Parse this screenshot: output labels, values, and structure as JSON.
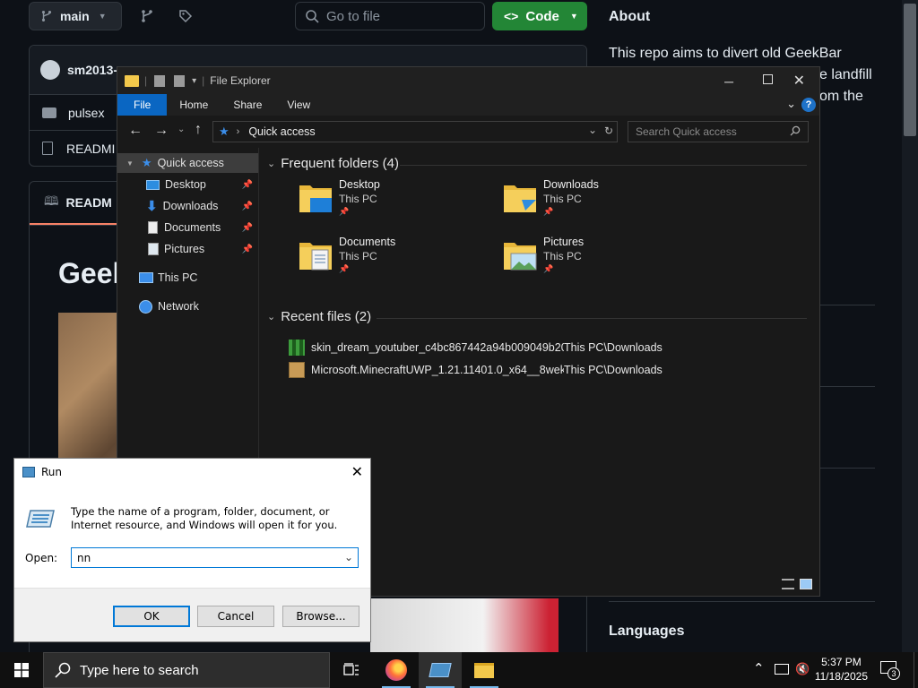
{
  "github": {
    "branch": "main",
    "search_placeholder": "Go to file",
    "code_label": "Code",
    "commit_user": "sm2013-",
    "folder_name": "pulsex",
    "readme_row": "READMI",
    "readme_tab": "READM",
    "heading_fragment": "Geek",
    "about_title": "About",
    "about_lines": [
      "This repo aims to divert old GeekBar",
      "e landfill",
      "om the"
    ],
    "languages_title": "Languages"
  },
  "explorer": {
    "title": "File Explorer",
    "tabs": [
      "File",
      "Home",
      "Share",
      "View"
    ],
    "address": "Quick access",
    "search_placeholder": "Search Quick access",
    "nav": {
      "quick_access": "Quick access",
      "pinned": [
        "Desktop",
        "Downloads",
        "Documents",
        "Pictures"
      ],
      "this_pc": "This PC",
      "network": "Network"
    },
    "frequent_title": "Frequent folders (4)",
    "folders": [
      {
        "name": "Desktop",
        "location": "This PC"
      },
      {
        "name": "Downloads",
        "location": "This PC"
      },
      {
        "name": "Documents",
        "location": "This PC"
      },
      {
        "name": "Pictures",
        "location": "This PC"
      }
    ],
    "recent_title": "Recent files (2)",
    "recent": [
      {
        "name": "skin_dream_youtuber_c4bc867442a94b009049b20...",
        "path": "This PC\\Downloads"
      },
      {
        "name": "Microsoft.MinecraftUWP_1.21.11401.0_x64__8wek...",
        "path": "This PC\\Downloads"
      }
    ]
  },
  "run": {
    "title": "Run",
    "description": "Type the name of a program, folder, document, or Internet resource, and Windows will open it for you.",
    "open_label": "Open:",
    "open_value": "nn",
    "ok": "OK",
    "cancel": "Cancel",
    "browse": "Browse..."
  },
  "taskbar": {
    "search_placeholder": "Type here to search",
    "time": "5:37 PM",
    "date": "11/18/2025",
    "notification_count": "3"
  }
}
